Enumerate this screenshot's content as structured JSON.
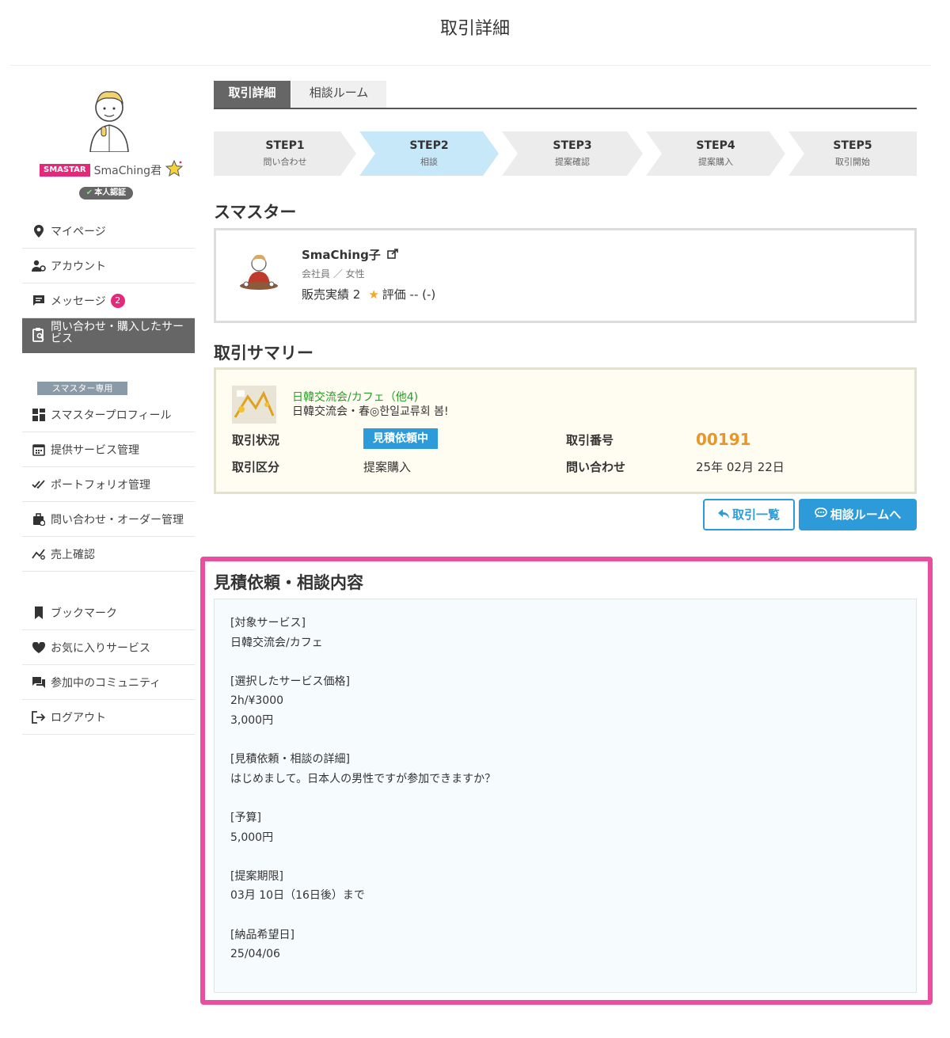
{
  "page": {
    "title": "取引詳細"
  },
  "profile": {
    "tag": "SMASTAR",
    "name": "SmaChing君",
    "verified": "本人認証"
  },
  "sidebar": {
    "menu_main": [
      {
        "label": "マイページ",
        "icon": "map-pin-icon"
      },
      {
        "label": "アカウント",
        "icon": "user-gear-icon"
      },
      {
        "label": "メッセージ",
        "icon": "message-icon",
        "badge": "2"
      },
      {
        "label": "問い合わせ・購入したサービス",
        "icon": "clipboard-search-icon",
        "active": true
      }
    ],
    "section_label": "スマスター専用",
    "menu_smastar": [
      {
        "label": "スマスタープロフィール",
        "icon": "dashboard-icon"
      },
      {
        "label": "提供サービス管理",
        "icon": "calendar-icon"
      },
      {
        "label": "ポートフォリオ管理",
        "icon": "double-check-icon"
      },
      {
        "label": "問い合わせ・オーダー管理",
        "icon": "briefcase-icon"
      },
      {
        "label": "売上確認",
        "icon": "chart-line-icon"
      }
    ],
    "menu_other": [
      {
        "label": "ブックマーク",
        "icon": "bookmark-icon"
      },
      {
        "label": "お気に入りサービス",
        "icon": "heart-icon"
      },
      {
        "label": "参加中のコミュニティ",
        "icon": "forum-icon"
      },
      {
        "label": "ログアウト",
        "icon": "logout-icon"
      }
    ]
  },
  "tabs": [
    {
      "label": "取引詳細",
      "active": true
    },
    {
      "label": "相談ルーム",
      "active": false
    }
  ],
  "steps": [
    {
      "title": "STEP1",
      "desc": "問い合わせ",
      "active": false
    },
    {
      "title": "STEP2",
      "desc": "相談",
      "active": true
    },
    {
      "title": "STEP3",
      "desc": "提案確認",
      "active": false
    },
    {
      "title": "STEP4",
      "desc": "提案購入",
      "active": false
    },
    {
      "title": "STEP5",
      "desc": "取引開始",
      "active": false
    }
  ],
  "smastar_section": {
    "heading": "スマスター",
    "name": "SmaChing子",
    "sub": "会社員 ／ 女性",
    "sales": "販売実績 2",
    "rating": "評価 -- (-)"
  },
  "summary": {
    "heading": "取引サマリー",
    "service_title": "日韓交流会/カフェ（他4)",
    "service_sub": "日韓交流会・春◎한일교류회 봄!",
    "status_label": "取引状況",
    "status_value": "見積依頼中",
    "order_label": "取引番号",
    "order_value": "00191",
    "type_label": "取引区分",
    "type_value": "提案購入",
    "inquiry_label": "問い合わせ",
    "inquiry_value": "25年 02月 22日"
  },
  "buttons": {
    "list": "取引一覧",
    "room": "相談ルームへ"
  },
  "inquiry": {
    "heading": "見積依頼・相談内容",
    "lines": [
      "[対象サービス]",
      "日韓交流会/カフェ",
      "",
      "[選択したサービス価格]",
      "2h/¥3000",
      "3,000円",
      "",
      "[見積依頼・相談の詳細]",
      "はじめまして。日本人の男性ですが参加できますか？",
      "",
      "[予算]",
      "5,000円",
      "",
      "[提案期限]",
      "03月 10日（16日後）まで",
      "",
      "[納品希望日]",
      "25/04/06"
    ]
  },
  "colors": {
    "accent": "#2d9bd9",
    "pink": "#e6287a",
    "highlight": "#ea4f9f",
    "step_active": "#c6e8f8",
    "step_inactive": "#ececec"
  }
}
